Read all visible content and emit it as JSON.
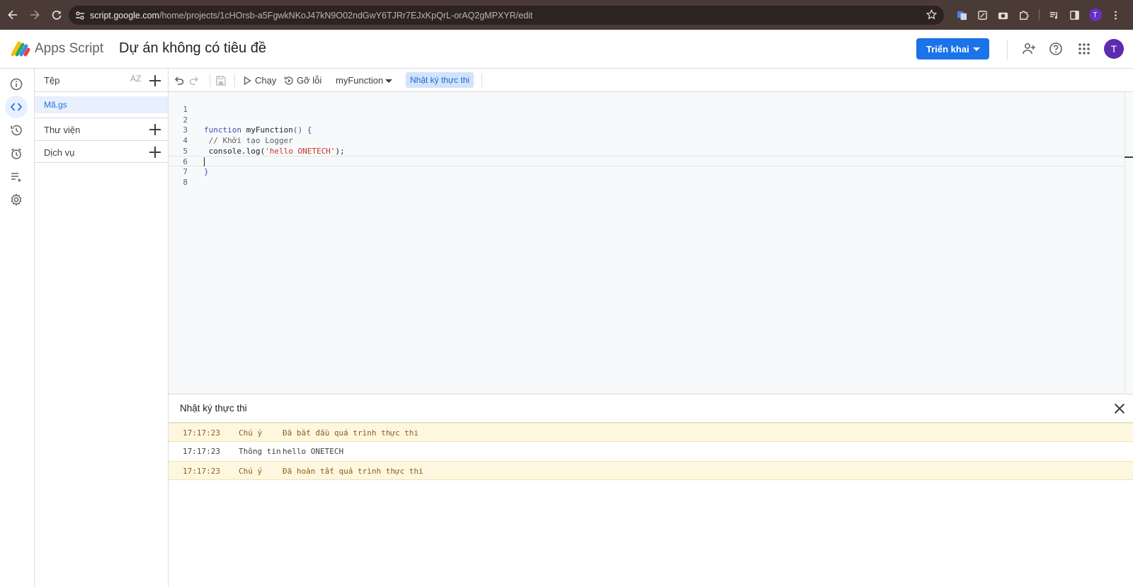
{
  "browser": {
    "url_host": "script.google.com",
    "url_path": "/home/projects/1cHOrsb-a5FgwkNKoJ47kN9O02ndGwY6TJRr7EJxKpQrL-orAQ2gMPXYR/edit",
    "avatar_letter": "T"
  },
  "header": {
    "app_name": "Apps Script",
    "project_title": "Dự án không có tiêu đề",
    "deploy_label": "Triển khai",
    "avatar_letter": "T",
    "accent": "#1a73e8"
  },
  "files_panel": {
    "title": "Tệp",
    "sort_label": "AZ",
    "file_name": "Mã.gs",
    "libraries_label": "Thư viện",
    "services_label": "Dịch vụ"
  },
  "toolbar": {
    "run_label": "Chạy",
    "debug_label": "Gỡ lỗi",
    "function_select": "myFunction",
    "log_toggle": "Nhật ký thực thi"
  },
  "editor": {
    "lines": [
      {
        "num": "1"
      },
      {
        "num": "2"
      },
      {
        "num": "3",
        "t1": "function",
        "t2": " myFunction",
        "t3": "() {"
      },
      {
        "num": "4",
        "t1": " // Khởi tạo Logger"
      },
      {
        "num": "5",
        "t1": " console.log(",
        "t2": "'hello ONETECH'",
        "t3": ");"
      },
      {
        "num": "6"
      },
      {
        "num": "7",
        "t1": "}"
      },
      {
        "num": "8"
      }
    ]
  },
  "log_panel": {
    "title": "Nhật ký thực thi",
    "rows": [
      {
        "time": "17:17:23",
        "level": "Chú ý",
        "message": "Đã bắt đầu quá trình thực thi"
      },
      {
        "time": "17:17:23",
        "level": "Thông tin",
        "message": "hello ONETECH"
      },
      {
        "time": "17:17:23",
        "level": "Chú ý",
        "message": "Đã hoàn tất quá trình thực thi"
      }
    ]
  }
}
